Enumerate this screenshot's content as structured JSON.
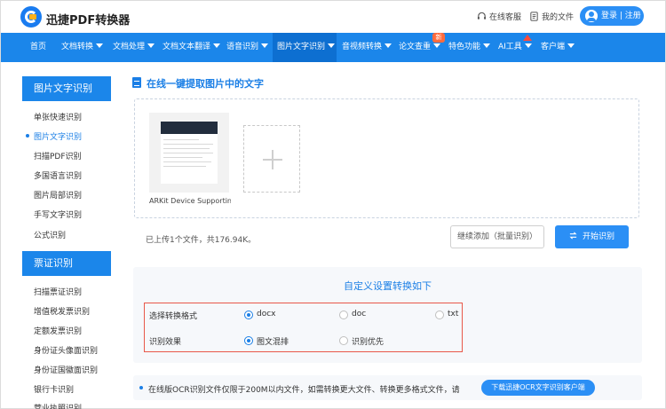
{
  "header": {
    "brand": "迅捷PDF转换器",
    "service_label": "在线客服",
    "files_label": "我的文件",
    "login_label": "登录 | 注册"
  },
  "nav": {
    "items": [
      {
        "label": "首页",
        "has_caret": false
      },
      {
        "label": "文档转换",
        "has_caret": true
      },
      {
        "label": "文档处理",
        "has_caret": true
      },
      {
        "label": "文档文本翻译",
        "has_caret": true
      },
      {
        "label": "语音识别",
        "has_caret": true
      },
      {
        "label": "图片文字识别",
        "has_caret": true,
        "active": true
      },
      {
        "label": "音视频转换",
        "has_caret": true
      },
      {
        "label": "论文查重",
        "has_caret": true
      },
      {
        "label": "特色功能",
        "has_caret": true
      },
      {
        "label": "AI工具",
        "has_caret": true
      },
      {
        "label": "客户端",
        "has_caret": true
      }
    ],
    "new_badge": "新"
  },
  "sidebar": {
    "group1_title": "图片文字识别",
    "group1_items": [
      "单张快速识别",
      "图片文字识别",
      "扫描PDF识别",
      "多国语言识别",
      "图片局部识别",
      "手写文字识别",
      "公式识别"
    ],
    "group1_active_index": 1,
    "group2_title": "票证识别",
    "group2_items": [
      "扫描票证识别",
      "增值税发票识别",
      "定额发票识别",
      "身份证头像面识别",
      "身份证国徽面识别",
      "银行卡识别",
      "营业执照识别"
    ]
  },
  "main": {
    "section_title": "在线一键提取图片中的文字",
    "file_name": "ARKit Device Supportin...",
    "upload_status": "已上传1个文件，共176.94K。",
    "continue_button": "继续添加（批量识别）",
    "start_button": "开始识别"
  },
  "settings": {
    "title": "自定义设置转换如下",
    "format_label": "选择转换格式",
    "format_options": [
      {
        "label": "docx",
        "selected": true
      },
      {
        "label": "doc",
        "selected": false
      },
      {
        "label": "txt",
        "selected": false
      }
    ],
    "effect_label": "识别效果",
    "effect_options": [
      {
        "label": "图文混排",
        "selected": true
      },
      {
        "label": "识别优先",
        "selected": false
      }
    ]
  },
  "notice": {
    "text": "在线版OCR识别文件仅限于200M以内文件，如需转换更大文件、转换更多格式文件，请",
    "download_button": "下载迅捷OCR文字识别客户端"
  },
  "colors": {
    "primary": "#1b86ea",
    "accent_red": "#e8584a",
    "new_badge": "#ff6b3d"
  }
}
